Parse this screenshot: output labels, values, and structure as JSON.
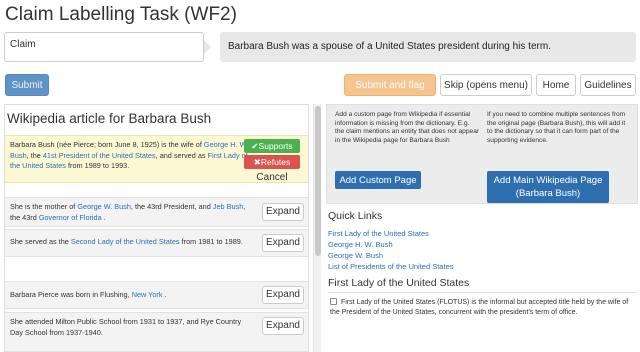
{
  "title": "Claim Labelling Task (WF2)",
  "claim": {
    "label": "Claim",
    "text": "Barbara Bush was a spouse of a United States president during his term."
  },
  "toolbar": {
    "submit": "Submit",
    "submit_flag": "Submit and flag",
    "skip": "Skip (opens menu)",
    "home": "Home",
    "guidelines": "Guidelines"
  },
  "left": {
    "heading": "Wikipedia article for Barbara Bush",
    "expand_label": "Expand",
    "actions": {
      "supports": "✔Supports",
      "refutes": "✖Refutes",
      "cancel": "Cancel"
    },
    "sentences": [
      {
        "parts": [
          "Barbara Bush (née Pierce; born June 8, 1925) is the wife of ",
          "George H. W. Bush",
          ", the ",
          "41st President of the United States",
          ", and served as ",
          "First Lady of the United States",
          " from 1989 to 1993."
        ]
      },
      {
        "parts": [
          "She is the mother of ",
          "George W. Bush",
          ", the 43rd President, and ",
          "Jeb Bush",
          ", the 43rd ",
          "Governor of Florida",
          " ."
        ]
      },
      {
        "parts": [
          "She served as the ",
          "Second Lady of the United States",
          " from 1981 to 1989."
        ]
      },
      {
        "parts": [
          "Barbara Pierce was born in Flushing, ",
          "New York",
          " ."
        ]
      },
      {
        "parts": [
          "She attended Milton Public School from 1931 to 1937, and Rye Country Day School from 1937-1940."
        ]
      }
    ]
  },
  "right": {
    "custom_text": "Add a custom page from Wikipedia if essential information is missing from the dictionary. E.g. the claim mentions an entity that does not appear in the Wikipedia page for Barbara Bush",
    "main_text": "If you need to combine multiple sentences from the original page (Barbara Bush), this will add it to the dictionary so that it can form part of the supporting evidence.",
    "add_custom": "Add Custom Page",
    "add_main": "Add Main Wikipedia Page (Barbara Bush)",
    "quick_links_title": "Quick Links",
    "quick_links": [
      "First Lady of the United States",
      "George H. W. Bush",
      "George W. Bush",
      "List of Presidents of the United States"
    ],
    "section_title": "First Lady of the United States",
    "section_text": "First Lady of the United States (FLOTUS) is the informal but accepted title held by the wife of the President of the United States, concurrent with the president's term of office."
  },
  "colors": {
    "link": "#2a6fb5",
    "submit": "#5f93c6",
    "flag": "#f6c48e",
    "blue_button": "#2e6fb0",
    "highlight": "#fcf8d3"
  }
}
